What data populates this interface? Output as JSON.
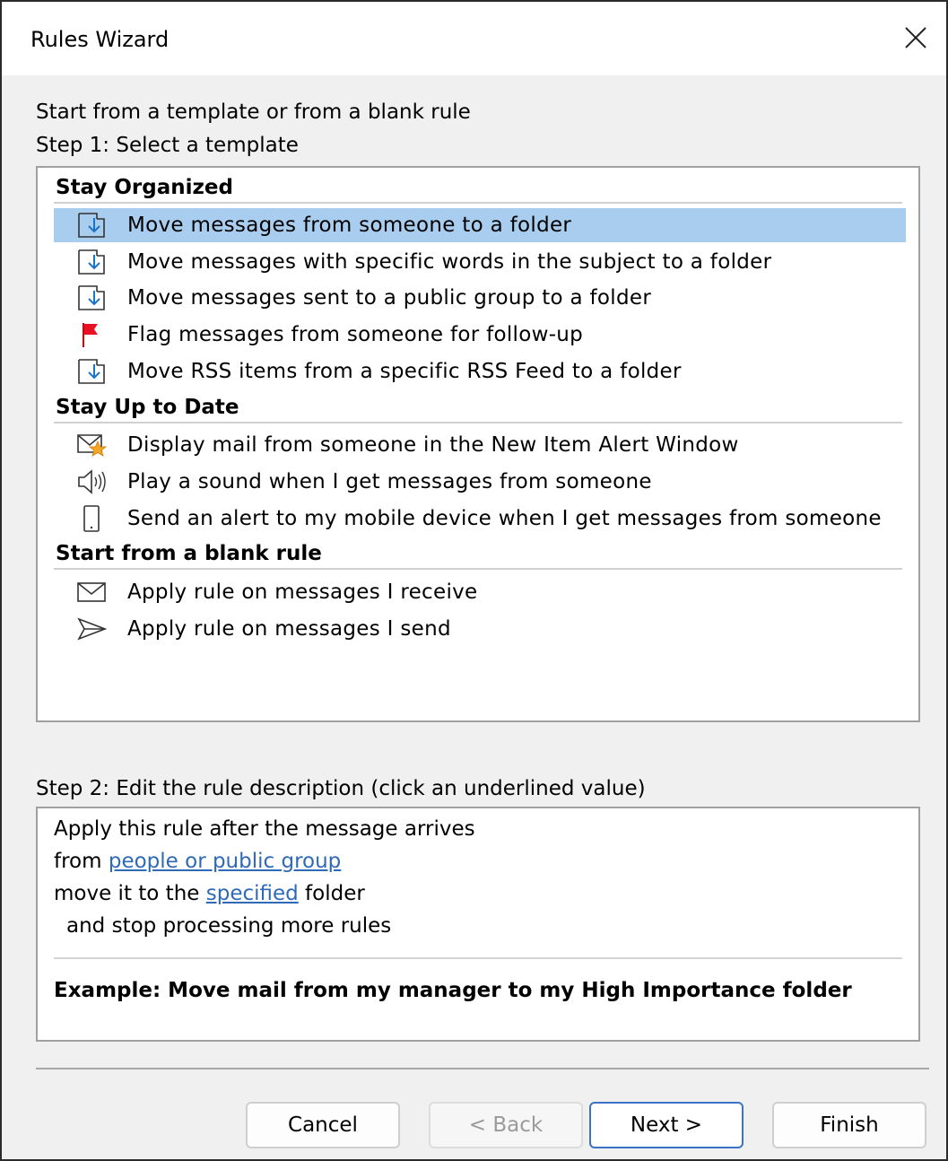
{
  "window": {
    "title": "Rules Wizard",
    "close_glyph": "✕"
  },
  "intro": "Start from a template or from a blank rule",
  "step1_label": "Step 1: Select a template",
  "groups": [
    {
      "heading": "Stay Organized",
      "items": [
        {
          "label": "Move messages from someone to a folder",
          "icon": "move-to-folder-icon",
          "selected": true
        },
        {
          "label": "Move messages with specific words in the subject to a folder",
          "icon": "move-to-folder-icon"
        },
        {
          "label": "Move messages sent to a public group to a folder",
          "icon": "move-to-folder-icon"
        },
        {
          "label": "Flag messages from someone for follow-up",
          "icon": "red-flag-icon"
        },
        {
          "label": "Move RSS items from a specific RSS Feed to a folder",
          "icon": "move-to-folder-icon"
        }
      ]
    },
    {
      "heading": "Stay Up to Date",
      "items": [
        {
          "label": "Display mail from someone in the New Item Alert Window",
          "icon": "mail-star-icon"
        },
        {
          "label": "Play a sound when I get messages from someone",
          "icon": "speaker-icon"
        },
        {
          "label": "Send an alert to my mobile device when I get messages from someone",
          "icon": "mobile-device-icon"
        }
      ]
    },
    {
      "heading": "Start from a blank rule",
      "items": [
        {
          "label": "Apply rule on messages I receive",
          "icon": "envelope-icon"
        },
        {
          "label": "Apply rule on messages I send",
          "icon": "send-icon"
        }
      ]
    }
  ],
  "step2_label": "Step 2: Edit the rule description (click an underlined value)",
  "description": {
    "line1": "Apply this rule after the message arrives",
    "line2_prefix": "from ",
    "line2_link": "people or public group",
    "line3_prefix": "move it to the ",
    "line3_link": "specified",
    "line3_suffix": " folder",
    "line4": "and stop processing more rules",
    "example": "Example: Move mail from my manager to my High Importance folder"
  },
  "buttons": {
    "cancel": "Cancel",
    "back": "< Back",
    "next": "Next >",
    "finish": "Finish"
  },
  "colors": {
    "selection": "#a9cdef",
    "link": "#2f6ab8",
    "flag": "#e81123",
    "default_button_border": "#3b73c7"
  }
}
